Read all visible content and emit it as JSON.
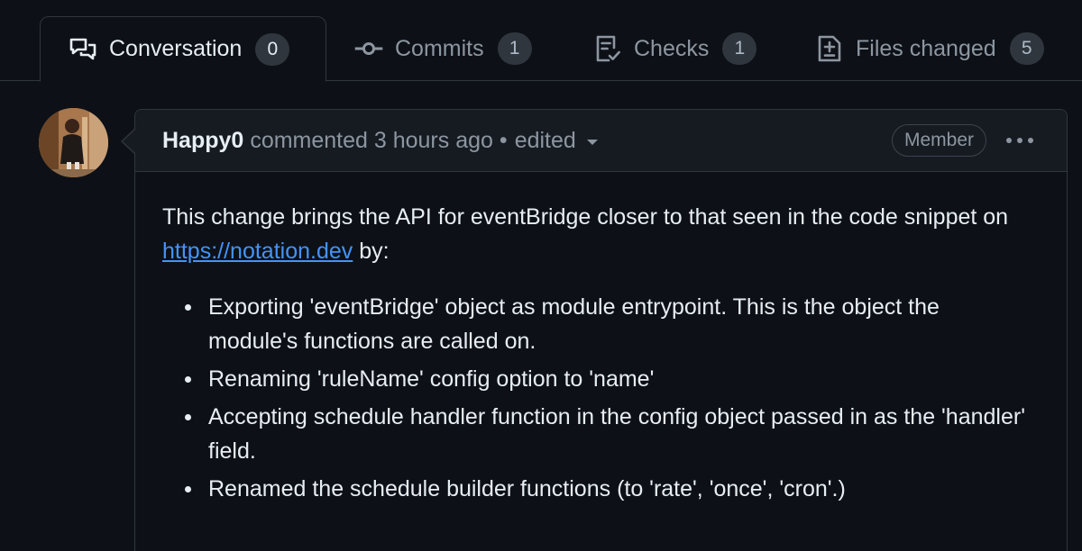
{
  "tabs": [
    {
      "label": "Conversation",
      "count": "0",
      "icon": "comment-discussion-icon"
    },
    {
      "label": "Commits",
      "count": "1",
      "icon": "git-commit-icon"
    },
    {
      "label": "Checks",
      "count": "1",
      "icon": "checklist-icon"
    },
    {
      "label": "Files changed",
      "count": "5",
      "icon": "file-diff-icon"
    }
  ],
  "comment": {
    "author": "Happy0",
    "action": "commented 3 hours ago",
    "separator": "•",
    "edited_label": "edited",
    "badge": "Member",
    "intro_before_link": "This change brings the API for eventBridge closer to that seen in the code snippet on ",
    "link_text": "https://notation.dev",
    "intro_after_link": " by:",
    "bullets": [
      "Exporting 'eventBridge' object as module entrypoint. This is the object the module's functions are called on.",
      "Renaming 'ruleName' config option to 'name'",
      "Accepting schedule handler function in the config object passed in as the 'handler' field.",
      "Renamed the schedule builder functions (to 'rate', 'once', 'cron'.)"
    ]
  },
  "colors": {
    "background": "#0d1117",
    "header": "#161b22",
    "border": "#30363d",
    "link": "#4493f8",
    "muted_text": "#8d96a0"
  }
}
